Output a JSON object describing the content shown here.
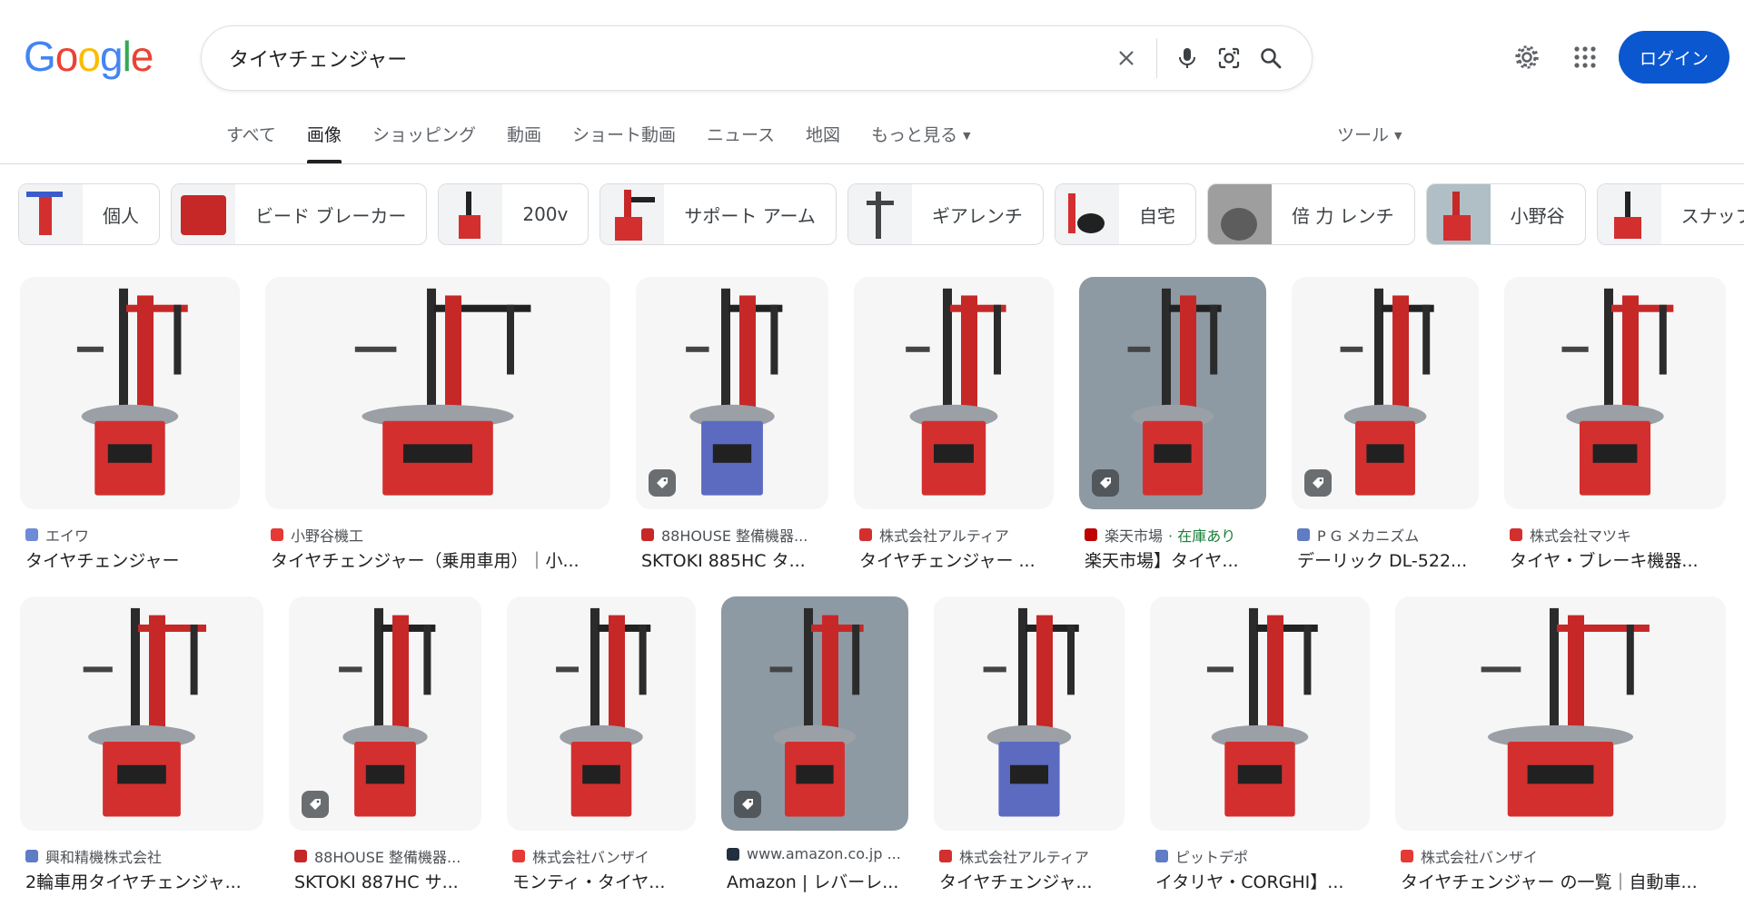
{
  "logo": {
    "letters": [
      "G",
      "o",
      "o",
      "g",
      "l",
      "e"
    ],
    "colors": [
      "#4285F4",
      "#EA4335",
      "#FBBC05",
      "#4285F4",
      "#34A853",
      "#EA4335"
    ]
  },
  "search": {
    "value": "タイヤチェンジャー"
  },
  "header": {
    "login_label": "ログイン"
  },
  "tabs": [
    {
      "label": "すべて",
      "active": false
    },
    {
      "label": "画像",
      "active": true
    },
    {
      "label": "ショッピング",
      "active": false
    },
    {
      "label": "動画",
      "active": false
    },
    {
      "label": "ショート動画",
      "active": false
    },
    {
      "label": "ニュース",
      "active": false
    },
    {
      "label": "地図",
      "active": false
    },
    {
      "label": "もっと見る",
      "active": false
    }
  ],
  "tools_label": "ツール",
  "chips": [
    {
      "label": "個人"
    },
    {
      "label": "ビード ブレーカー"
    },
    {
      "label": "200v"
    },
    {
      "label": "サポート アーム"
    },
    {
      "label": "ギアレンチ"
    },
    {
      "label": "自宅"
    },
    {
      "label": "倍 力 レンチ"
    },
    {
      "label": "小野谷"
    },
    {
      "label": "スナップ オン"
    }
  ],
  "results_row1": [
    {
      "source": "エイワ",
      "title": "タイヤチェンジャー",
      "fav": "#6d8bd6"
    },
    {
      "source": "小野谷機工",
      "title": "タイヤチェンジャー（乗用車用）｜小...",
      "fav": "#e53935"
    },
    {
      "source": "88HOUSE 整備機器...",
      "title": "SKTOKI 885HC タ...",
      "fav": "#c62828"
    },
    {
      "source": "株式会社アルティア",
      "title": "タイヤチェンジャー ...",
      "fav": "#d32f2f"
    },
    {
      "source": "楽天市場",
      "stock": "· 在庫あり",
      "title": "楽天市場】タイヤ...",
      "fav": "#bf0000"
    },
    {
      "source": "P G メカニズム",
      "title": "デーリック DL-522...",
      "fav": "#5f7cc4"
    },
    {
      "source": "株式会社マツキ",
      "title": "タイヤ・ブレーキ機器...",
      "fav": "#d32f2f"
    }
  ],
  "results_row2": [
    {
      "source": "興和精機株式会社",
      "title": "2輪車用タイヤチェンジャ...",
      "fav": "#5f7cc4"
    },
    {
      "source": "88HOUSE 整備機器...",
      "title": "SKTOKI 887HC サ...",
      "fav": "#c62828"
    },
    {
      "source": "株式会社バンザイ",
      "title": "モンティ・タイヤ...",
      "fav": "#e53935"
    },
    {
      "source": "www.amazon.co.jp ...",
      "title": "Amazon | レバーレ...",
      "fav": "#232f3e"
    },
    {
      "source": "株式会社アルティア",
      "title": "タイヤチェンジャ...",
      "fav": "#d32f2f"
    },
    {
      "source": "ピットデポ",
      "title": "イタリヤ・CORGHI】...",
      "fav": "#5f7cc4"
    },
    {
      "source": "株式会社バンザイ",
      "title": "タイヤチェンジャー の一覧｜自動車...",
      "fav": "#e53935"
    }
  ]
}
